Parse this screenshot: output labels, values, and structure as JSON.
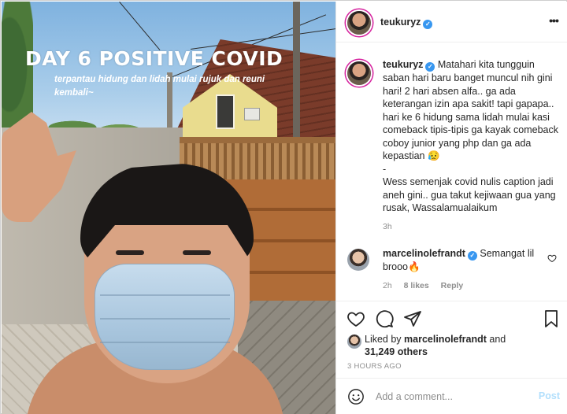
{
  "photo": {
    "overlay_title": "DAY 6 POSITIVE COVID",
    "overlay_subtitle": "terpantau hidung dan lidah mulai rujuk dan reuni kembali~"
  },
  "header": {
    "username": "teukuryz",
    "verified_icon": "check-badge",
    "more_icon": "•••"
  },
  "caption": {
    "username": "teukuryz",
    "text": " Matahari kita tungguin saban hari baru banget muncul nih gini hari! 2 hari absen alfa.. ga ada keterangan izin apa sakit! tapi gapapa.. hari ke 6 hidung sama lidah mulai kasi comeback tipis-tipis ga kayak comeback coboy junior yang php dan ga ada kepastian 😥",
    "dash": "-",
    "text2": "Wess semenjak covid nulis caption jadi aneh gini.. gua takut kejiwaan gua yang rusak, Wassalamualaikum",
    "time": "3h"
  },
  "comment": {
    "username": "marcelinolefrandt",
    "text": " Semangat lil brooo🔥",
    "time": "2h",
    "likes": "8 likes",
    "reply": "Reply"
  },
  "actions": {
    "liked_by_prefix": "Liked by ",
    "liked_by_user": "marcelinolefrandt",
    "liked_by_and": " and",
    "others": "31,249 others",
    "post_time": "3 HOURS AGO"
  },
  "comment_bar": {
    "placeholder": "Add a comment...",
    "post_label": "Post"
  },
  "colors": {
    "verified": "#3897f0",
    "post_disabled": "#b2dffc",
    "muted": "#8e8e8e",
    "story_ring": "#d6249f"
  }
}
